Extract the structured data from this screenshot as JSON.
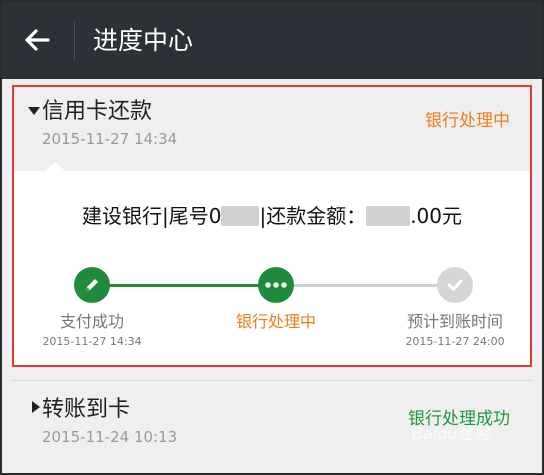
{
  "header": {
    "title": "进度中心",
    "back_icon": "arrow-left-icon"
  },
  "card1": {
    "title": "信用卡还款",
    "date": "2015-11-27 14:34",
    "status": "银行处理中",
    "status_color": "#ee7d1a",
    "detail": {
      "part1": "建设银行|尾号0",
      "part2": "|还款金额：",
      "part3": ".00元"
    },
    "steps": [
      {
        "label": "支付成功",
        "date": "2015-11-27 14:34",
        "icon": "pencil-icon",
        "state": "done"
      },
      {
        "label": "银行处理中",
        "date": "",
        "icon": "dots-icon",
        "state": "current"
      },
      {
        "label": "预计到账时间",
        "date": "2015-11-27 24:00",
        "icon": "check-icon",
        "state": "pending"
      }
    ]
  },
  "card2": {
    "title": "转账到卡",
    "date": "2015-11-24 10:13",
    "status": "银行处理成功",
    "status_color": "#1e9a3e"
  },
  "colors": {
    "green": "#1e8c3c",
    "orange": "#ee7d1a",
    "header_bg": "#2b3137",
    "highlight_border": "#e53935"
  },
  "watermark": "Baidu经验"
}
